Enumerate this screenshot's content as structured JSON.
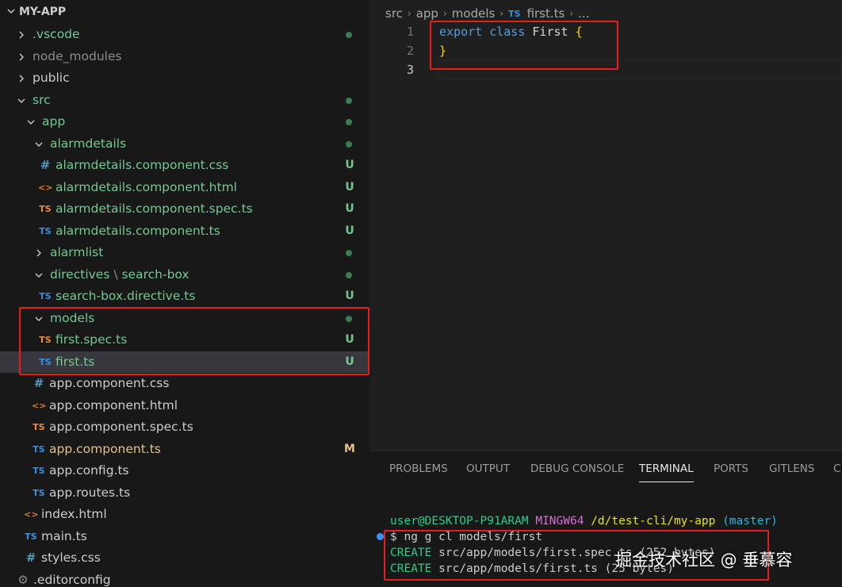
{
  "explorer": {
    "root_label": "MY-APP",
    "items": [
      {
        "name": ".vscode",
        "indent": 0,
        "kind": "folder",
        "expanded": false,
        "color": "green",
        "status": "dot"
      },
      {
        "name": "node_modules",
        "indent": 0,
        "kind": "folder",
        "expanded": false,
        "color": "gray",
        "status": ""
      },
      {
        "name": "public",
        "indent": 0,
        "kind": "folder",
        "expanded": false,
        "color": "white",
        "status": ""
      },
      {
        "name": "src",
        "indent": 0,
        "kind": "folder",
        "expanded": true,
        "color": "green",
        "status": "dot"
      },
      {
        "name": "app",
        "indent": 1,
        "kind": "folder",
        "expanded": true,
        "color": "green",
        "status": "dot"
      },
      {
        "name": "alarmdetails",
        "indent": 2,
        "kind": "folder",
        "expanded": true,
        "color": "green",
        "status": "dot"
      },
      {
        "name": "alarmdetails.component.css",
        "indent": 3,
        "kind": "css",
        "color": "green",
        "status": "U"
      },
      {
        "name": "alarmdetails.component.html",
        "indent": 3,
        "kind": "html",
        "color": "green",
        "status": "U"
      },
      {
        "name": "alarmdetails.component.spec.ts",
        "indent": 3,
        "kind": "tsspec",
        "color": "green",
        "status": "U"
      },
      {
        "name": "alarmdetails.component.ts",
        "indent": 3,
        "kind": "ts",
        "color": "green",
        "status": "U"
      },
      {
        "name": "alarmlist",
        "indent": 2,
        "kind": "folder",
        "expanded": false,
        "color": "green",
        "status": "dot"
      },
      {
        "name": "directives",
        "name_suffix": "search-box",
        "indent": 2,
        "kind": "folder",
        "expanded": true,
        "color": "green",
        "status": "dot"
      },
      {
        "name": "search-box.directive.ts",
        "indent": 3,
        "kind": "ts",
        "color": "green",
        "status": "U"
      },
      {
        "name": "models",
        "indent": 2,
        "kind": "folder",
        "expanded": true,
        "color": "green",
        "status": "dot"
      },
      {
        "name": "first.spec.ts",
        "indent": 3,
        "kind": "tsspec",
        "color": "green",
        "status": "U"
      },
      {
        "name": "first.ts",
        "indent": 3,
        "kind": "ts",
        "color": "green",
        "status": "U",
        "selected": true
      },
      {
        "name": "app.component.css",
        "indent": 2,
        "kind": "css",
        "color": "white",
        "status": ""
      },
      {
        "name": "app.component.html",
        "indent": 2,
        "kind": "html",
        "color": "white",
        "status": ""
      },
      {
        "name": "app.component.spec.ts",
        "indent": 2,
        "kind": "tsspec",
        "color": "white",
        "status": ""
      },
      {
        "name": "app.component.ts",
        "indent": 2,
        "kind": "ts",
        "color": "yellow",
        "status": "M"
      },
      {
        "name": "app.config.ts",
        "indent": 2,
        "kind": "ts",
        "color": "white",
        "status": ""
      },
      {
        "name": "app.routes.ts",
        "indent": 2,
        "kind": "ts",
        "color": "white",
        "status": ""
      },
      {
        "name": "index.html",
        "indent": 1,
        "kind": "html",
        "color": "white",
        "status": ""
      },
      {
        "name": "main.ts",
        "indent": 1,
        "kind": "ts",
        "color": "white",
        "status": ""
      },
      {
        "name": "styles.css",
        "indent": 1,
        "kind": "css",
        "color": "white",
        "status": ""
      },
      {
        "name": ".editorconfig",
        "indent": 0,
        "kind": "gear",
        "color": "white",
        "status": ""
      }
    ]
  },
  "editor": {
    "breadcrumb": [
      "src",
      "app",
      "models",
      "first.ts",
      "..."
    ],
    "breadcrumb_file_icon": "TS",
    "lines": [
      {
        "number": "1",
        "tokens": [
          [
            "kw",
            "export"
          ],
          [
            "sp",
            " "
          ],
          [
            "kw",
            "class"
          ],
          [
            "sp",
            " "
          ],
          [
            "cls",
            "First"
          ],
          [
            "sp",
            " "
          ],
          [
            "brace",
            "{"
          ]
        ]
      },
      {
        "number": "2",
        "tokens": [
          [
            "brace",
            "}"
          ]
        ]
      },
      {
        "number": "3",
        "tokens": []
      }
    ]
  },
  "panel": {
    "tabs": [
      "PROBLEMS",
      "OUTPUT",
      "DEBUG CONSOLE",
      "TERMINAL",
      "PORTS",
      "GITLENS",
      "C"
    ],
    "active_tab": "TERMINAL",
    "terminal": {
      "prompt_user": "user@DESKTOP-P91ARAM",
      "prompt_host": "MINGW64",
      "prompt_path": "/d/test-cli/my-app",
      "prompt_branch": "(master)",
      "command": "$ ng g cl models/first",
      "create_label": "CREATE",
      "create_lines": [
        {
          "path": "src/app/models/first.spec.ts",
          "size": "(252 bytes)"
        },
        {
          "path": "src/app/models/first.ts",
          "size": "(25 bytes)"
        }
      ]
    }
  },
  "watermark": "掘金技术社区 @ 垂慕容",
  "colors": {
    "highlight_box": "#e81e1e",
    "untracked": "#73c991",
    "modified": "#e2c08d"
  }
}
